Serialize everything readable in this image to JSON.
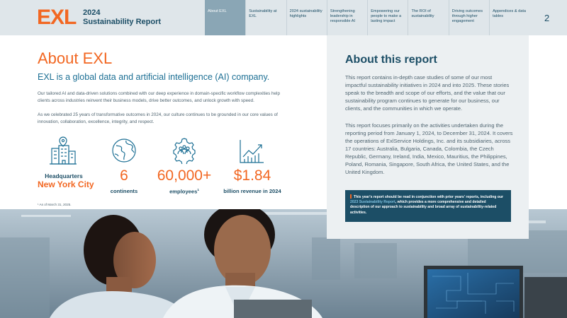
{
  "header": {
    "logo_text": "EXL",
    "report_year": "2024",
    "report_name": "Sustainability Report",
    "page_number": "2",
    "nav": [
      {
        "label": "About EXL",
        "active": true
      },
      {
        "label": "Sustainability at EXL",
        "active": false
      },
      {
        "label": "2024 sustainability highlights",
        "active": false
      },
      {
        "label": "Strengthening leadership in responsible AI",
        "active": false
      },
      {
        "label": "Empowering our people to make a lasting impact",
        "active": false
      },
      {
        "label": "The ROI of sustainability",
        "active": false
      },
      {
        "label": "Driving outcomes through higher engagement",
        "active": false
      },
      {
        "label": "Appendices & data tables",
        "active": false
      }
    ]
  },
  "about": {
    "title": "About EXL",
    "tagline": "EXL is a global data and artificial intelligence (AI) company.",
    "paragraph1": "Our tailored AI and data-driven solutions combined with our deep experience in domain-specific workflow complexities help clients across industries reinvent their business models, drive better outcomes, and unlock growth with speed.",
    "paragraph2": "As we celebrated 25 years of transformative outcomes in 2024, our culture continues to be grounded in our core values of innovation, collaboration, excellence, integrity, and respect.",
    "stats": {
      "hq_label": "Headquarters",
      "hq_city": "New York City",
      "continents_value": "6",
      "continents_label": "continents",
      "employees_value": "60,000+",
      "employees_label": "employees",
      "employees_footnote_mark": "1",
      "revenue_value": "$1.84",
      "revenue_label": "billion revenue in 2024"
    },
    "icons": {
      "hq": "building-pin-icon",
      "continents": "globe-icon",
      "employees": "people-gear-icon",
      "revenue": "growth-chart-icon"
    },
    "footnote": "¹ As of March 31, 2025."
  },
  "report": {
    "title": "About this report",
    "paragraph1": "This report contains in-depth case studies of some of our most impactful sustainability initiatives in 2024 and into 2025. These stories speak to the breadth and scope of our efforts, and the value that our sustainability program continues to generate for our business, our clients, and the communities in which we operate.",
    "paragraph2": "This report focuses primarily on the activities undertaken during the reporting period from January 1, 2024, to December 31, 2024. It covers the operations of ExlService Holdings, Inc. and its subsidiaries, across 17 countries: Australia, Bulgaria, Canada, Colombia, the Czech Republic, Germany, Ireland, India, Mexico, Mauritius, the Philippines, Poland, Romania, Singapore, South Africa, the United States, and the United Kingdom.",
    "callout_before": "This year's report should be read in conjunction with prior years' reports, including our ",
    "callout_link": "2023 Sustainability Report",
    "callout_after": ", which provides a more comprehensive and detailed description of our approach to sustainability and broad array of sustainability-related activities."
  },
  "colors": {
    "brand_orange": "#f26722",
    "navy": "#1c4e66",
    "teal_text": "#1c6f94",
    "active_nav": "#8aa6b5",
    "panel_bg": "#ecf0f2"
  }
}
